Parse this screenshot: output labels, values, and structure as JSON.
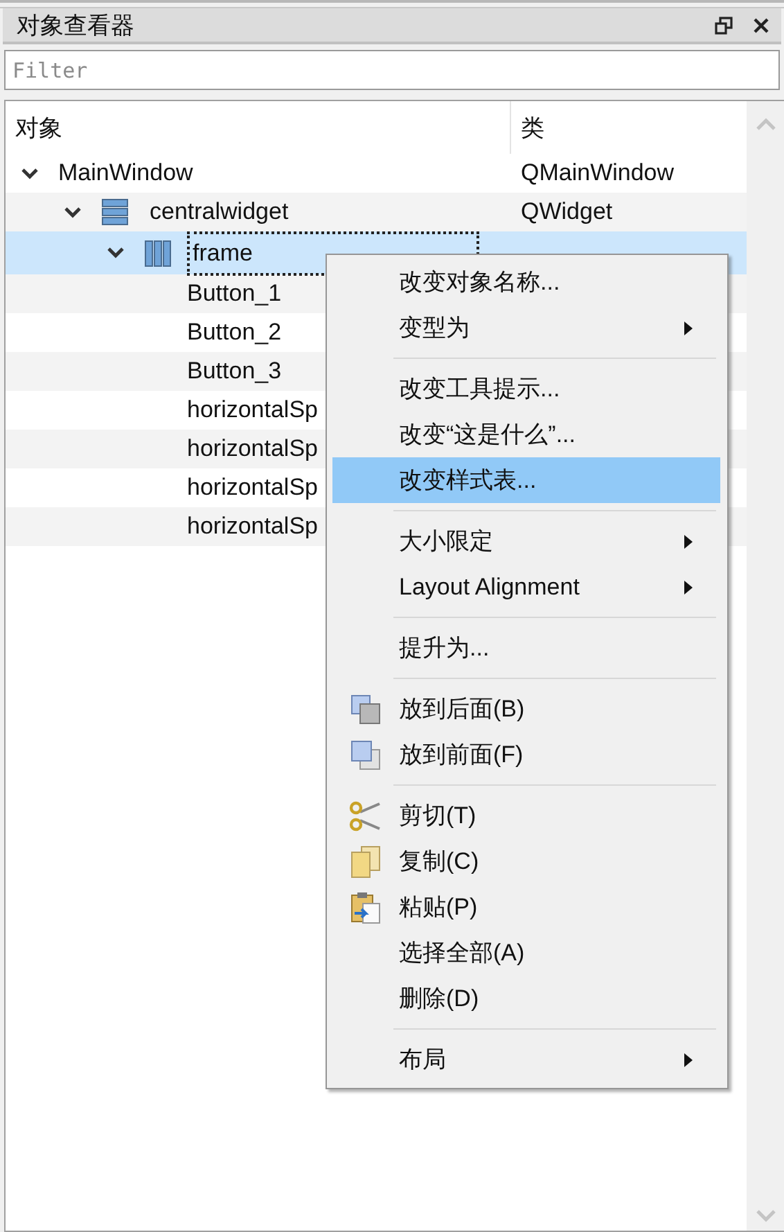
{
  "panel": {
    "title": "对象查看器"
  },
  "filter": {
    "placeholder": "Filter"
  },
  "tree": {
    "columns": [
      "对象",
      "类"
    ],
    "items": [
      {
        "name": "MainWindow",
        "class": "QMainWindow",
        "expanded": true,
        "selected": false,
        "children": [
          {
            "name": "centralwidget",
            "class": "QWidget",
            "kind": "layout",
            "expanded": true,
            "selected": false,
            "children": [
              {
                "name": "frame",
                "kind": "frame",
                "expanded": true,
                "selected": true,
                "children": [
                  {
                    "name": "Button_1",
                    "selected": false
                  },
                  {
                    "name": "Button_2",
                    "selected": false
                  },
                  {
                    "name": "Button_3",
                    "selected": false
                  },
                  {
                    "name": "horizontalSp",
                    "selected": false
                  },
                  {
                    "name": "horizontalSp",
                    "selected": false
                  },
                  {
                    "name": "horizontalSp",
                    "selected": false
                  },
                  {
                    "name": "horizontalSp",
                    "selected": false
                  }
                ]
              }
            ]
          }
        ]
      }
    ]
  },
  "context_menu": [
    {
      "kind": "item",
      "label": "改变对象名称...",
      "selected": false
    },
    {
      "kind": "submenu",
      "label": "变型为",
      "selected": false
    },
    {
      "kind": "separator"
    },
    {
      "kind": "item",
      "label": "改变工具提示...",
      "selected": false
    },
    {
      "kind": "item",
      "label": "改变“这是什么”...",
      "selected": false
    },
    {
      "kind": "item",
      "label": "改变样式表...",
      "selected": true
    },
    {
      "kind": "separator"
    },
    {
      "kind": "submenu",
      "label": "大小限定",
      "selected": false
    },
    {
      "kind": "submenu",
      "label": "Layout Alignment",
      "selected": false
    },
    {
      "kind": "separator"
    },
    {
      "kind": "item",
      "label": "提升为...",
      "selected": false
    },
    {
      "kind": "separator"
    },
    {
      "kind": "item",
      "label": "放到后面(B)",
      "selected": false
    },
    {
      "kind": "item",
      "label": "放到前面(F)",
      "selected": false
    },
    {
      "kind": "separator"
    },
    {
      "kind": "item",
      "label": "剪切(T)",
      "selected": false
    },
    {
      "kind": "item",
      "label": "复制(C)",
      "selected": false
    },
    {
      "kind": "item",
      "label": "粘贴(P)",
      "selected": false
    },
    {
      "kind": "item",
      "label": "选择全部(A)",
      "selected": false
    },
    {
      "kind": "item",
      "label": "删除(D)",
      "selected": false
    },
    {
      "kind": "separator"
    },
    {
      "kind": "submenu",
      "label": "布局",
      "selected": false
    }
  ]
}
